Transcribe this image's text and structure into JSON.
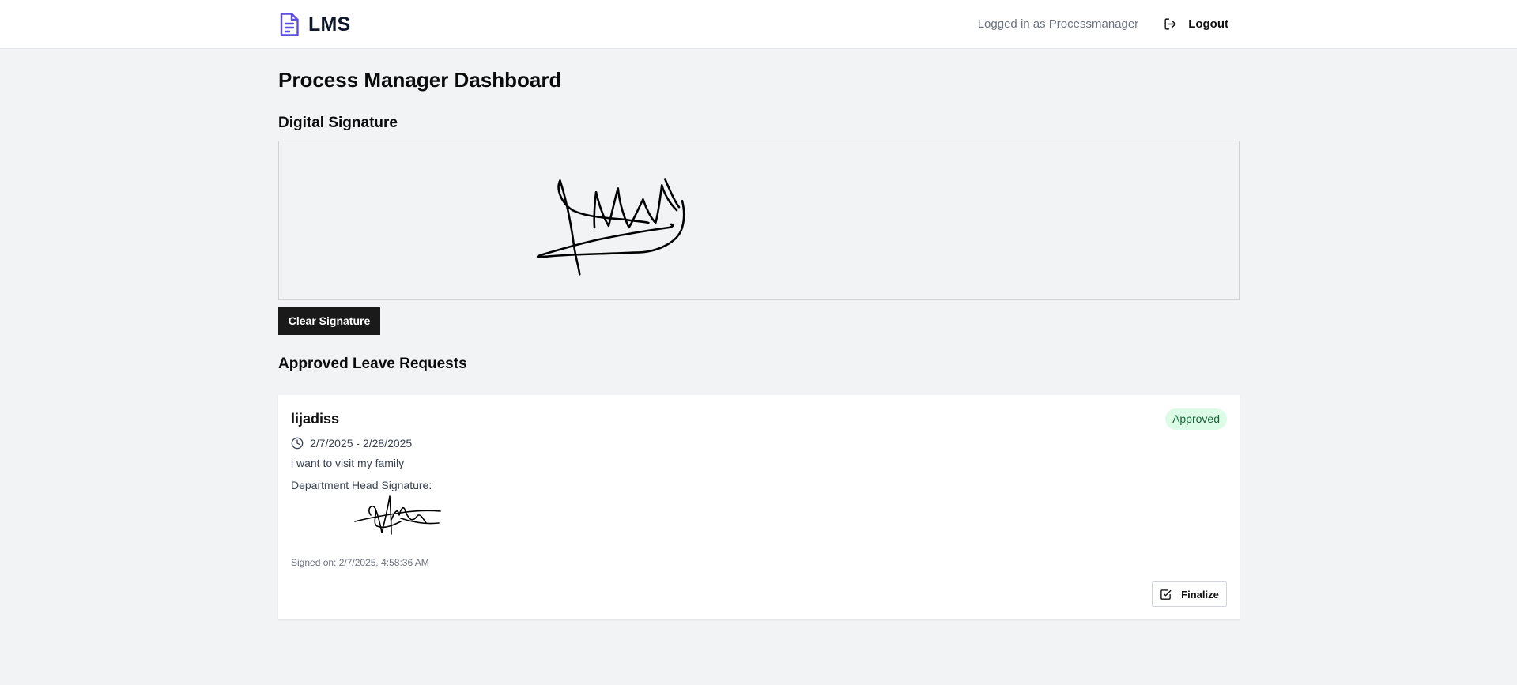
{
  "header": {
    "app_name": "LMS",
    "logo_icon": "document-icon",
    "logged_in_text": "Logged in as Processmanager",
    "logout_label": "Logout",
    "logout_icon": "logout-icon"
  },
  "page": {
    "title": "Process Manager Dashboard"
  },
  "signature_section": {
    "title": "Digital Signature",
    "clear_label": "Clear Signature"
  },
  "approved_section": {
    "title": "Approved Leave Requests",
    "requests": [
      {
        "employee": "lijadiss",
        "status": "Approved",
        "date_range": "2/7/2025 - 2/28/2025",
        "reason": "i want to visit my family",
        "signature_label": "Department Head Signature:",
        "signed_on": "Signed on: 2/7/2025, 4:58:36 AM",
        "finalize_label": "Finalize"
      }
    ]
  },
  "colors": {
    "accent": "#5b4de0",
    "badge_bg": "#dcfce7",
    "badge_text": "#166534",
    "button_dark": "#1a1a1a",
    "page_bg": "#f2f3f5"
  }
}
